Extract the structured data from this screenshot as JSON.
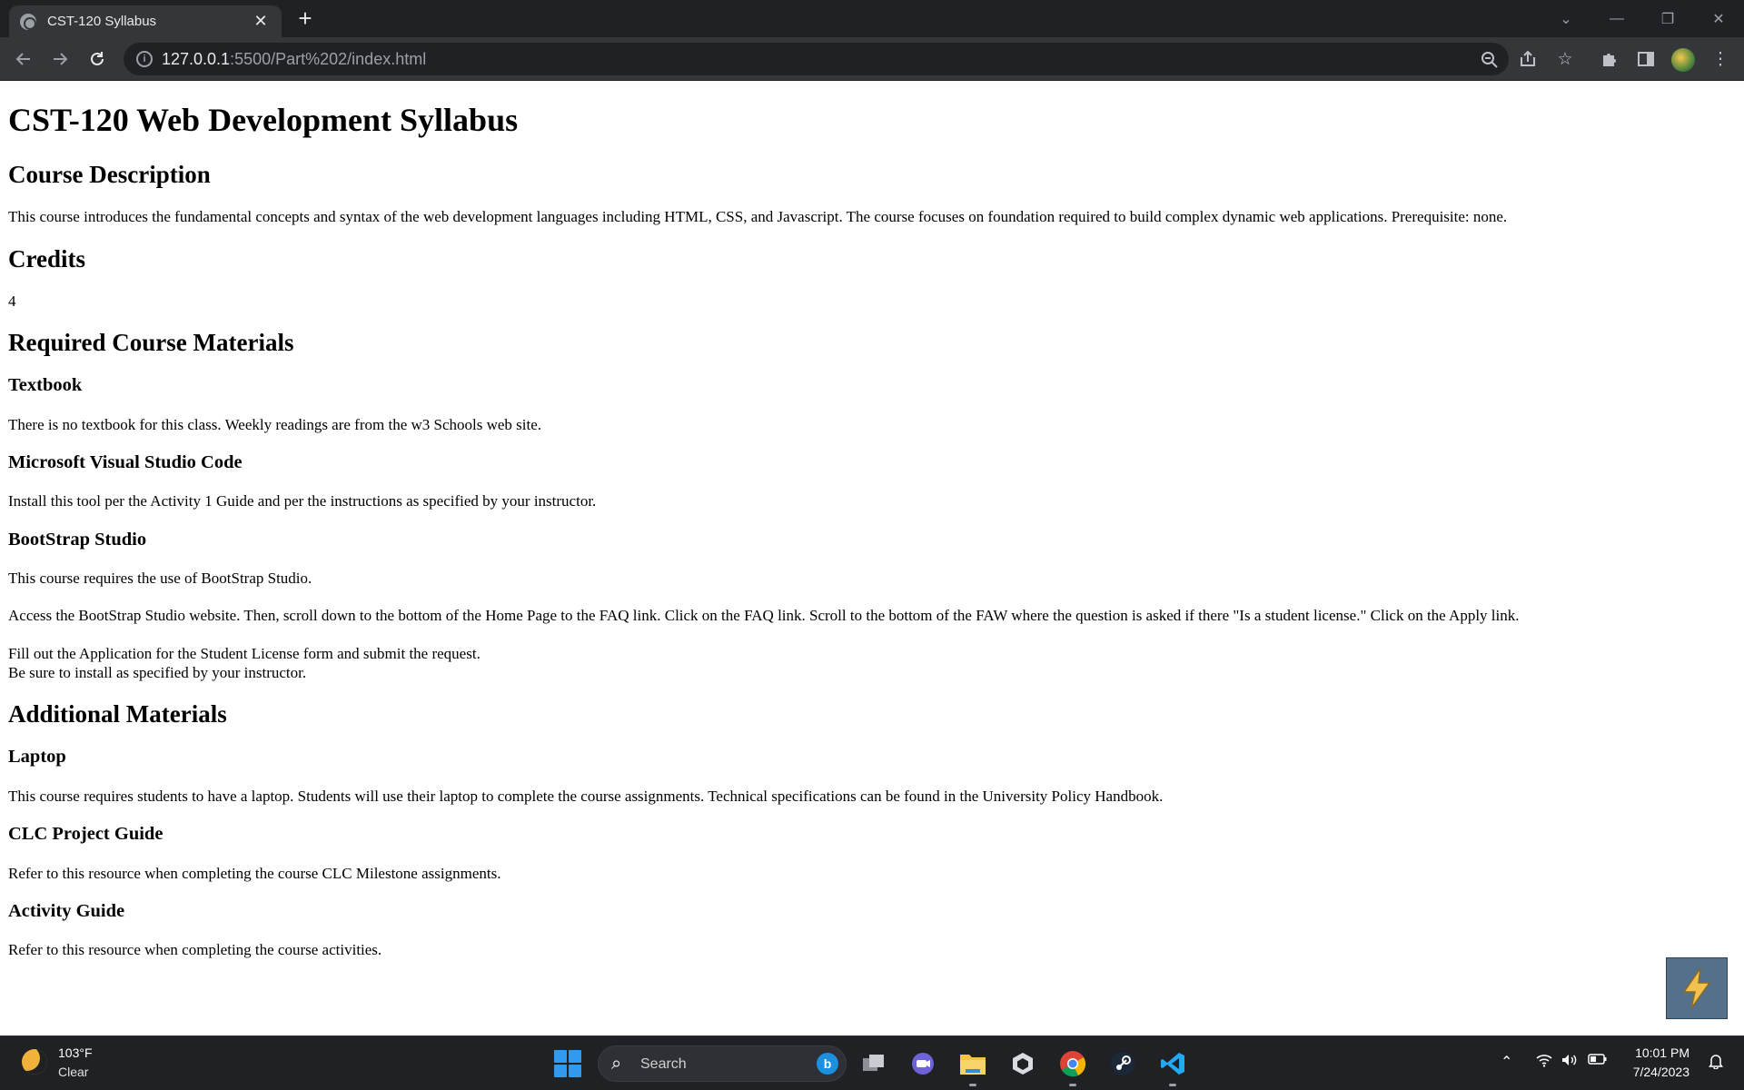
{
  "browser": {
    "tab_title": "CST-120 Syllabus",
    "url_host": "127.0.0.1",
    "url_rest": ":5500/Part%202/index.html"
  },
  "page": {
    "title": "CST-120 Web Development Syllabus",
    "course_description_heading": "Course Description",
    "course_description_text": "This course introduces the fundamental concepts and syntax of the web development languages including HTML, CSS, and Javascript. The course focuses on foundation required to build complex dynamic web applications. Prerequisite: none.",
    "credits_heading": "Credits",
    "credits_value": "4",
    "required_materials_heading": "Required Course Materials",
    "textbook_heading": "Textbook",
    "textbook_text": "There is no textbook for this class. Weekly readings are from the w3 Schools web site.",
    "vscode_heading": "Microsoft Visual Studio Code",
    "vscode_text": "Install this tool per the Activity 1 Guide and per the instructions as specified by your instructor.",
    "bootstrap_heading": "BootStrap Studio",
    "bootstrap_text_1": "This course requires the use of BootStrap Studio.",
    "bootstrap_text_2": "Access the BootStrap Studio website. Then, scroll down to the bottom of the Home Page to the FAQ link. Click on the FAQ link. Scroll to the bottom of the FAW where the question is asked if there \"Is a student license.\" Click on the Apply link.",
    "bootstrap_text_3_line1": "Fill out the Application for the Student License form and submit the request.",
    "bootstrap_text_3_line2": "Be sure to install as specified by your instructor.",
    "additional_materials_heading": "Additional Materials",
    "laptop_heading": "Laptop",
    "laptop_text": "This course requires students to have a laptop. Students will use their laptop to complete the course assignments. Technical specifications can be found in the University Policy Handbook.",
    "clc_heading": "CLC Project Guide",
    "clc_text": "Refer to this resource when completing the course CLC Milestone assignments.",
    "activity_heading": "Activity Guide",
    "activity_text": "Refer to this resource when completing the course activities."
  },
  "taskbar": {
    "weather_temp": "103°F",
    "weather_desc": "Clear",
    "search_label": "Search",
    "time": "10:01 PM",
    "date": "7/24/2023"
  },
  "icons": {
    "tab_favicon": "globe-icon",
    "back": "arrow-left-icon",
    "forward": "arrow-right-icon",
    "reload": "reload-icon",
    "zoom": "zoom-out-icon",
    "share": "share-icon",
    "bookmark": "star-icon",
    "extensions": "puzzle-icon",
    "side_panel": "side-panel-icon",
    "menu": "kebab-menu-icon"
  }
}
